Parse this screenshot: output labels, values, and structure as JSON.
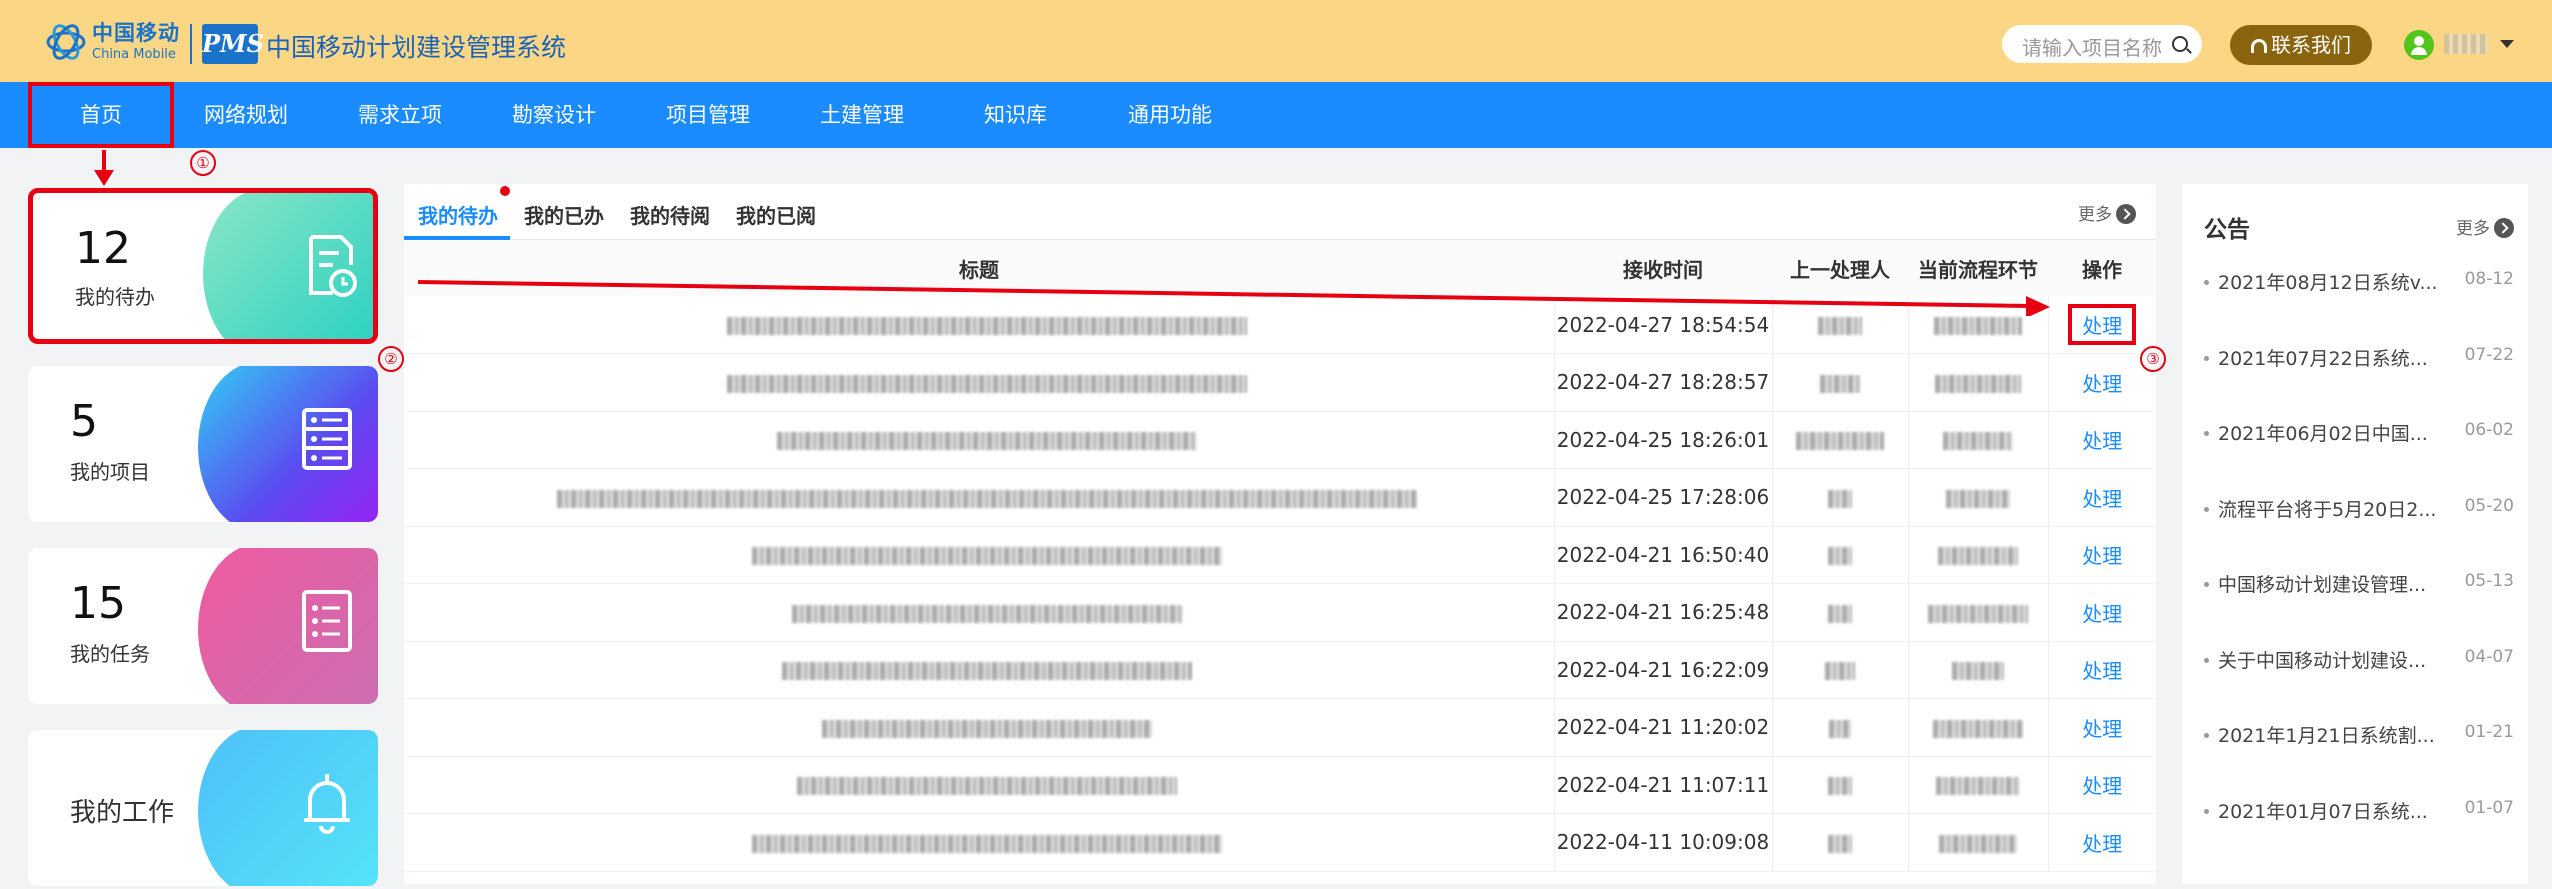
{
  "header": {
    "brand_cn": "中国移动",
    "brand_en": "China Mobile",
    "pms": "PMS",
    "system_title": "中国移动计划建设管理系统",
    "search_placeholder": "请输入项目名称",
    "contact_label": "联系我们"
  },
  "nav": [
    "首页",
    "网络规划",
    "需求立项",
    "勘察设计",
    "项目管理",
    "土建管理",
    "知识库",
    "通用功能"
  ],
  "cards": [
    {
      "num": "12",
      "label": "我的待办",
      "icon": "todo-doc-clock-icon"
    },
    {
      "num": "5",
      "label": "我的项目",
      "icon": "server-list-icon"
    },
    {
      "num": "15",
      "label": "我的任务",
      "icon": "task-list-icon"
    },
    {
      "num": "",
      "label": "我的工作",
      "icon": "bell-icon"
    }
  ],
  "tabs": [
    "我的待办",
    "我的已办",
    "我的待阅",
    "我的已阅"
  ],
  "more_label": "更多",
  "table": {
    "headers": [
      "标题",
      "接收时间",
      "上一处理人",
      "当前流程环节",
      "操作"
    ],
    "action_label": "处理",
    "rows": [
      {
        "time": "2022-04-27 18:54:54"
      },
      {
        "time": "2022-04-27 18:28:57"
      },
      {
        "time": "2022-04-25 18:26:01"
      },
      {
        "time": "2022-04-25 17:28:06"
      },
      {
        "time": "2022-04-21 16:50:40"
      },
      {
        "time": "2022-04-21 16:25:48"
      },
      {
        "time": "2022-04-21 16:22:09"
      },
      {
        "time": "2022-04-21 11:20:02"
      },
      {
        "time": "2022-04-21 11:07:11"
      },
      {
        "time": "2022-04-11 10:09:08"
      }
    ]
  },
  "notice": {
    "title": "公告",
    "more_label": "更多",
    "items": [
      {
        "text": "2021年08月12日系统v...",
        "date": "08-12"
      },
      {
        "text": "2021年07月22日系统...",
        "date": "07-22"
      },
      {
        "text": "2021年06月02日中国...",
        "date": "06-02"
      },
      {
        "text": "流程平台将于5月20日2...",
        "date": "05-20"
      },
      {
        "text": "中国移动计划建设管理...",
        "date": "05-13"
      },
      {
        "text": "关于中国移动计划建设...",
        "date": "04-07"
      },
      {
        "text": "2021年1月21日系统割...",
        "date": "01-21"
      },
      {
        "text": "2021年01月07日系统...",
        "date": "01-07"
      }
    ]
  },
  "annotations": [
    "①",
    "②",
    "③"
  ],
  "colors": {
    "header_bg": "#fbd785",
    "nav_bg": "#1a8cff",
    "annotation": "#e60012",
    "link": "#1a8cff"
  }
}
